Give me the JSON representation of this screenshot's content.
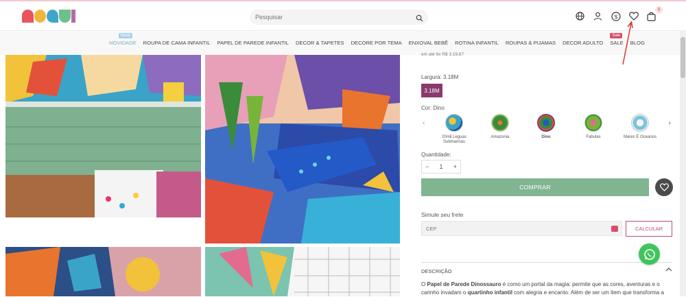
{
  "header": {
    "logo_text": "MOGUI",
    "search_placeholder": "Pesquisar",
    "icons": [
      "globe-icon",
      "user-icon",
      "currency-icon",
      "heart-icon",
      "bag-icon"
    ],
    "cart_count": "0"
  },
  "nav": {
    "items": [
      {
        "label": "NOVIDADE",
        "tag": "Novo"
      },
      {
        "label": "ROUPA DE CAMA INFANTIL"
      },
      {
        "label": "PAPEL DE PAREDE INFANTIL"
      },
      {
        "label": "DECOR & TAPETES"
      },
      {
        "label": "DECORE POR TEMA"
      },
      {
        "label": "ENXOVAL BEBÊ"
      },
      {
        "label": "ROTINA INFANTIL"
      },
      {
        "label": "ROUPAS & PIJAMAS"
      },
      {
        "label": "DECOR ADULTO"
      },
      {
        "label": "SALE",
        "tag": "Sale"
      },
      {
        "label": "BLOG"
      }
    ]
  },
  "product": {
    "installments_partial": "em até 6x R$ 3.19,67",
    "size_label": "Largura:",
    "size_value": "3.18M",
    "size_option": "3.18M",
    "color_label": "Cor:",
    "color_value": "Dino",
    "swatches": [
      {
        "name": "20mil Leguas Submarinas"
      },
      {
        "name": "Amazonia"
      },
      {
        "name": "Dino"
      },
      {
        "name": "Fabulas"
      },
      {
        "name": "Mares E Oceanos"
      }
    ],
    "quantity_label": "Quantidade:",
    "quantity_value": "1",
    "qty_minus": "−",
    "qty_plus": "+",
    "buy_label": "COMPRAR",
    "shipping_title": "Simule seu frete",
    "cep_placeholder": "CEP",
    "calc_label": "CALCULAR",
    "description_title": "DESCRIÇÃO",
    "description_text_1": "O ",
    "description_bold_1": "Papel de Parede Dinossauro",
    "description_text_2": " é como um portal da magia: permite que as cores, aventuras e o carinho invadam o ",
    "description_bold_2": "quartinho infantil",
    "description_text_3": " com alegria e encanto. Além de ser um item que transforma a"
  },
  "colors": {
    "accent": "#8a3a6c",
    "buy": "#81b592",
    "whatsapp": "#3fc55c",
    "nav_active": "#7aa7c8"
  }
}
